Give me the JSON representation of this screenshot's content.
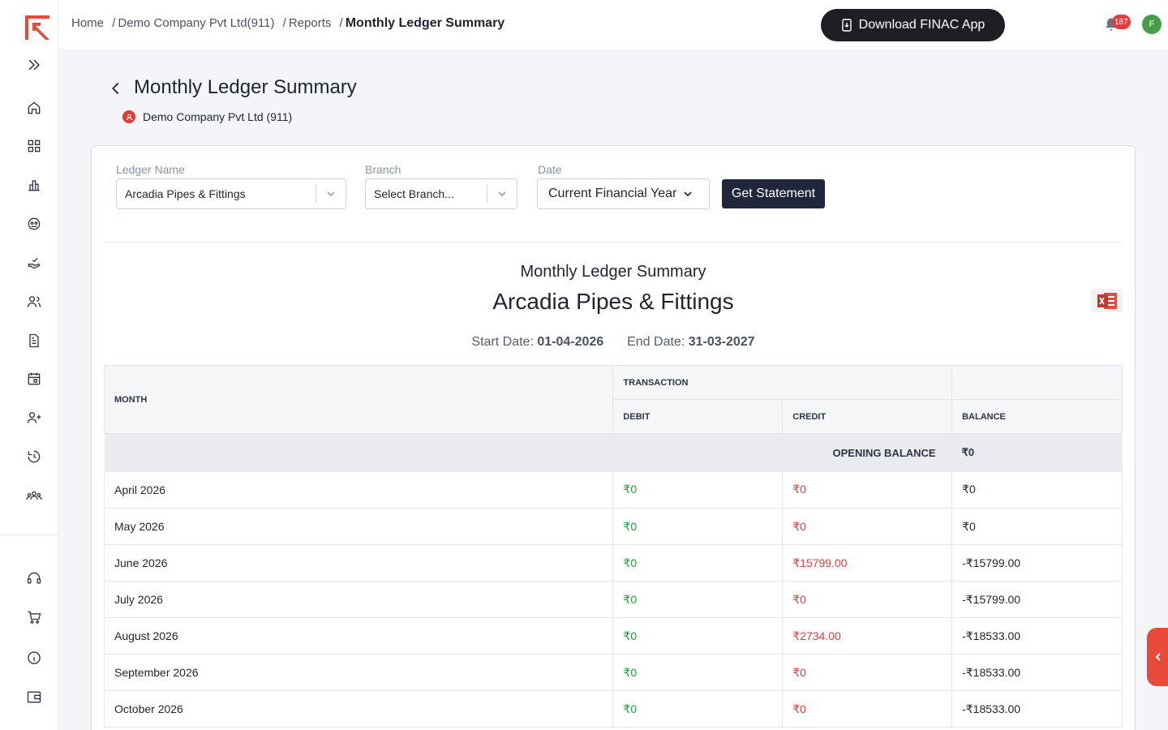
{
  "breadcrumb": {
    "home": "Home",
    "company": "Demo Company Pvt Ltd(911)",
    "reports": "Reports",
    "current": "Monthly Ledger Summary"
  },
  "topbar": {
    "download_label": "Download FINAC App",
    "notification_count": "187",
    "avatar_initial": "F"
  },
  "page": {
    "title": "Monthly Ledger Summary",
    "company": "Demo Company Pvt Ltd (911)"
  },
  "filters": {
    "ledger_label": "Ledger Name",
    "ledger_value": "Arcadia Pipes & Fittings",
    "branch_label": "Branch",
    "branch_placeholder": "Select Branch...",
    "date_label": "Date",
    "date_value": "Current Financial Year",
    "submit_label": "Get Statement"
  },
  "report": {
    "subtitle": "Monthly Ledger Summary",
    "ledger": "Arcadia Pipes & Fittings",
    "start_label": "Start Date:",
    "start_date": "01-04-2026",
    "end_label": "End Date:",
    "end_date": "31-03-2027"
  },
  "table": {
    "headers": {
      "month": "MONTH",
      "transaction": "TRANSACTION",
      "debit": "DEBIT",
      "credit": "CREDIT",
      "balance": "BALANCE"
    },
    "opening_label": "OPENING BALANCE",
    "opening_value": "₹0",
    "rows": [
      {
        "month": "April 2026",
        "debit": "₹0",
        "credit": "₹0",
        "balance": "₹0"
      },
      {
        "month": "May 2026",
        "debit": "₹0",
        "credit": "₹0",
        "balance": "₹0"
      },
      {
        "month": "June 2026",
        "debit": "₹0",
        "credit": "₹15799.00",
        "balance": "-₹15799.00"
      },
      {
        "month": "July 2026",
        "debit": "₹0",
        "credit": "₹0",
        "balance": "-₹15799.00"
      },
      {
        "month": "August 2026",
        "debit": "₹0",
        "credit": "₹2734.00",
        "balance": "-₹18533.00"
      },
      {
        "month": "September 2026",
        "debit": "₹0",
        "credit": "₹0",
        "balance": "-₹18533.00"
      },
      {
        "month": "October 2026",
        "debit": "₹0",
        "credit": "₹0",
        "balance": "-₹18533.00"
      }
    ]
  },
  "colors": {
    "brand": "#e84a3a",
    "debit": "#1aa33c",
    "credit": "#e03d3d",
    "dark_button": "#22263a"
  },
  "sidebar": {
    "icons": [
      "expand-icon",
      "home-icon",
      "grid-icon",
      "chart-icon",
      "wallet-icon",
      "hand-check-icon",
      "users-icon",
      "document-icon",
      "calendar-icon",
      "user-add-icon",
      "history-settings-icon",
      "team-icon",
      "support-icon",
      "cart-icon",
      "info-icon",
      "card-wallet-icon"
    ]
  }
}
